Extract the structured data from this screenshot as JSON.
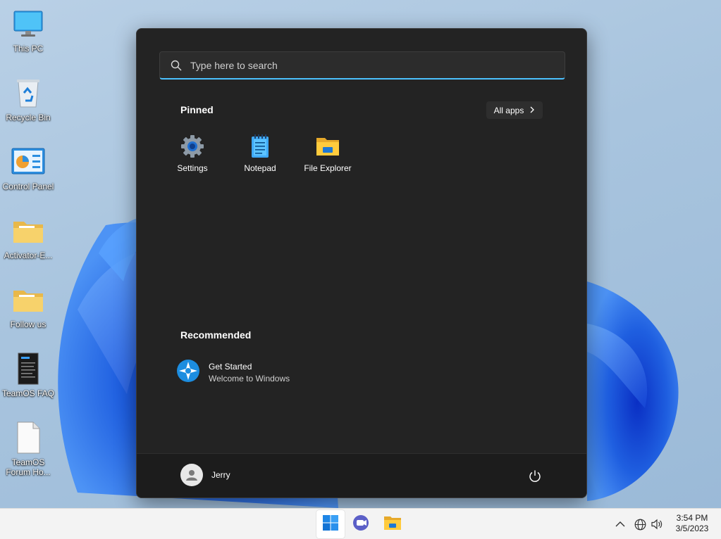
{
  "desktop": {
    "icons": [
      {
        "label": "This PC",
        "icon": "computer-icon"
      },
      {
        "label": "Recycle Bin",
        "icon": "recycle-bin-icon"
      },
      {
        "label": "Control Panel",
        "icon": "control-panel-icon"
      },
      {
        "label": "Activator-E...",
        "icon": "folder-icon"
      },
      {
        "label": "Follow us",
        "icon": "folder-icon"
      },
      {
        "label": "TeamOS FAQ",
        "icon": "document-dark-icon"
      },
      {
        "label": "TeamOS Forum Ho...",
        "icon": "file-icon"
      }
    ]
  },
  "start_menu": {
    "search": {
      "placeholder": "Type here to search"
    },
    "pinned": {
      "title": "Pinned",
      "all_apps_label": "All apps",
      "apps": [
        {
          "label": "Settings",
          "icon": "gear-icon"
        },
        {
          "label": "Notepad",
          "icon": "notepad-icon"
        },
        {
          "label": "File Explorer",
          "icon": "folder-icon"
        }
      ]
    },
    "recommended": {
      "title": "Recommended",
      "items": [
        {
          "title": "Get Started",
          "subtitle": "Welcome to Windows",
          "icon": "get-started-icon"
        }
      ]
    },
    "user": {
      "name": "Jerry",
      "icon": "user-avatar-icon"
    },
    "power_icon": "power-icon"
  },
  "taskbar": {
    "apps": [
      "start-icon",
      "teams-chat-icon",
      "file-explorer-icon"
    ],
    "tray": [
      "chevron-up-icon",
      "globe-icon",
      "speaker-icon"
    ],
    "clock": {
      "time": "3:54 PM",
      "date": "3/5/2023"
    }
  },
  "colors": {
    "accent": "#4cc2ff",
    "menu_bg": "#232323",
    "taskbar_bg": "#f3f3f3",
    "wallpaper_bloom": "#1f5fe0"
  }
}
